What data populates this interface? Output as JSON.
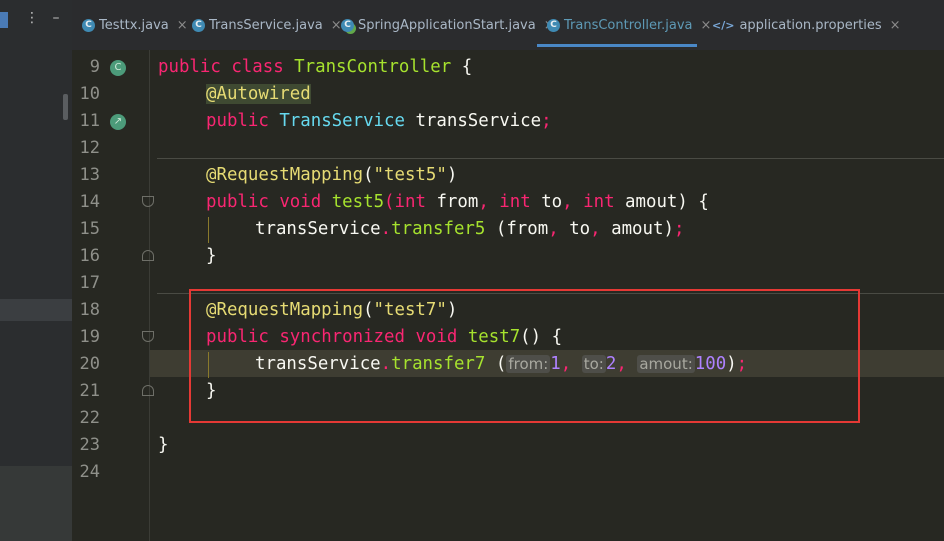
{
  "side_panel": {
    "more_icon": "more-vertical-icon",
    "minimize_icon": "minimize-icon"
  },
  "tabs": [
    {
      "label": "Testtx.java",
      "icon": "C",
      "active": false
    },
    {
      "label": "TransService.java",
      "icon": "C",
      "active": false
    },
    {
      "label": "SpringApplicationStart.java",
      "icon": "C",
      "active": false
    },
    {
      "label": "TransController.java",
      "icon": "C",
      "active": true
    },
    {
      "label": "application.properties",
      "icon": "</>",
      "active": false
    }
  ],
  "close_glyph": "×",
  "line_numbers": [
    "9",
    "10",
    "11",
    "12",
    "13",
    "14",
    "15",
    "16",
    "17",
    "18",
    "19",
    "20",
    "21",
    "22",
    "23",
    "24"
  ],
  "code": {
    "l9": {
      "kw1": "public",
      "kw2": "class",
      "cls": "TransController",
      "brace": "{"
    },
    "l10": {
      "at": "@",
      "ann": "Autowired"
    },
    "l11": {
      "kw": "public",
      "type": "TransService",
      "name": "transService",
      "semi": ";"
    },
    "l13": {
      "ann": "@RequestMapping",
      "open": "(",
      "str": "\"test5\"",
      "close": ")"
    },
    "l14": {
      "kw1": "public",
      "kw2": "void",
      "fn": "test5",
      "open": "(",
      "t1": "int",
      "p1": "from",
      "c1": ",",
      "t2": "int",
      "p2": "to",
      "c2": ",",
      "t3": "int",
      "p3": "amout",
      "close": ")",
      "brace": "{"
    },
    "l15": {
      "obj": "transService",
      "dot": ".",
      "fn": "transfer5",
      "args_open": "(",
      "a1": "from",
      "c1": ",",
      "a2": "to",
      "c2": ",",
      "a3": "amout",
      "args_close": ")",
      "semi": ";"
    },
    "l16": {
      "brace": "}"
    },
    "l18": {
      "ann": "@RequestMapping",
      "open": "(",
      "str": "\"test7\"",
      "close": ")"
    },
    "l19": {
      "kw1": "public",
      "kw2": "synchronized",
      "kw3": "void",
      "fn": "test7",
      "parens": "()",
      "brace": "{"
    },
    "l20": {
      "obj": "transService",
      "dot": ".",
      "fn": "transfer7",
      "args_open": "(",
      "h1": "from:",
      "v1": "1",
      "c1": ",",
      "h2": "to:",
      "v2": "2",
      "c2": ",",
      "h3": "amout:",
      "v3": "100",
      "args_close": ")",
      "semi": ";"
    },
    "l21": {
      "brace": "}"
    },
    "l23": {
      "brace": "}"
    }
  },
  "colors": {
    "keyword": "#f92672",
    "class": "#66d9ef",
    "function": "#a6e22e",
    "string": "#e6db74",
    "number": "#ae81ff",
    "highlight_box": "#e53935"
  }
}
